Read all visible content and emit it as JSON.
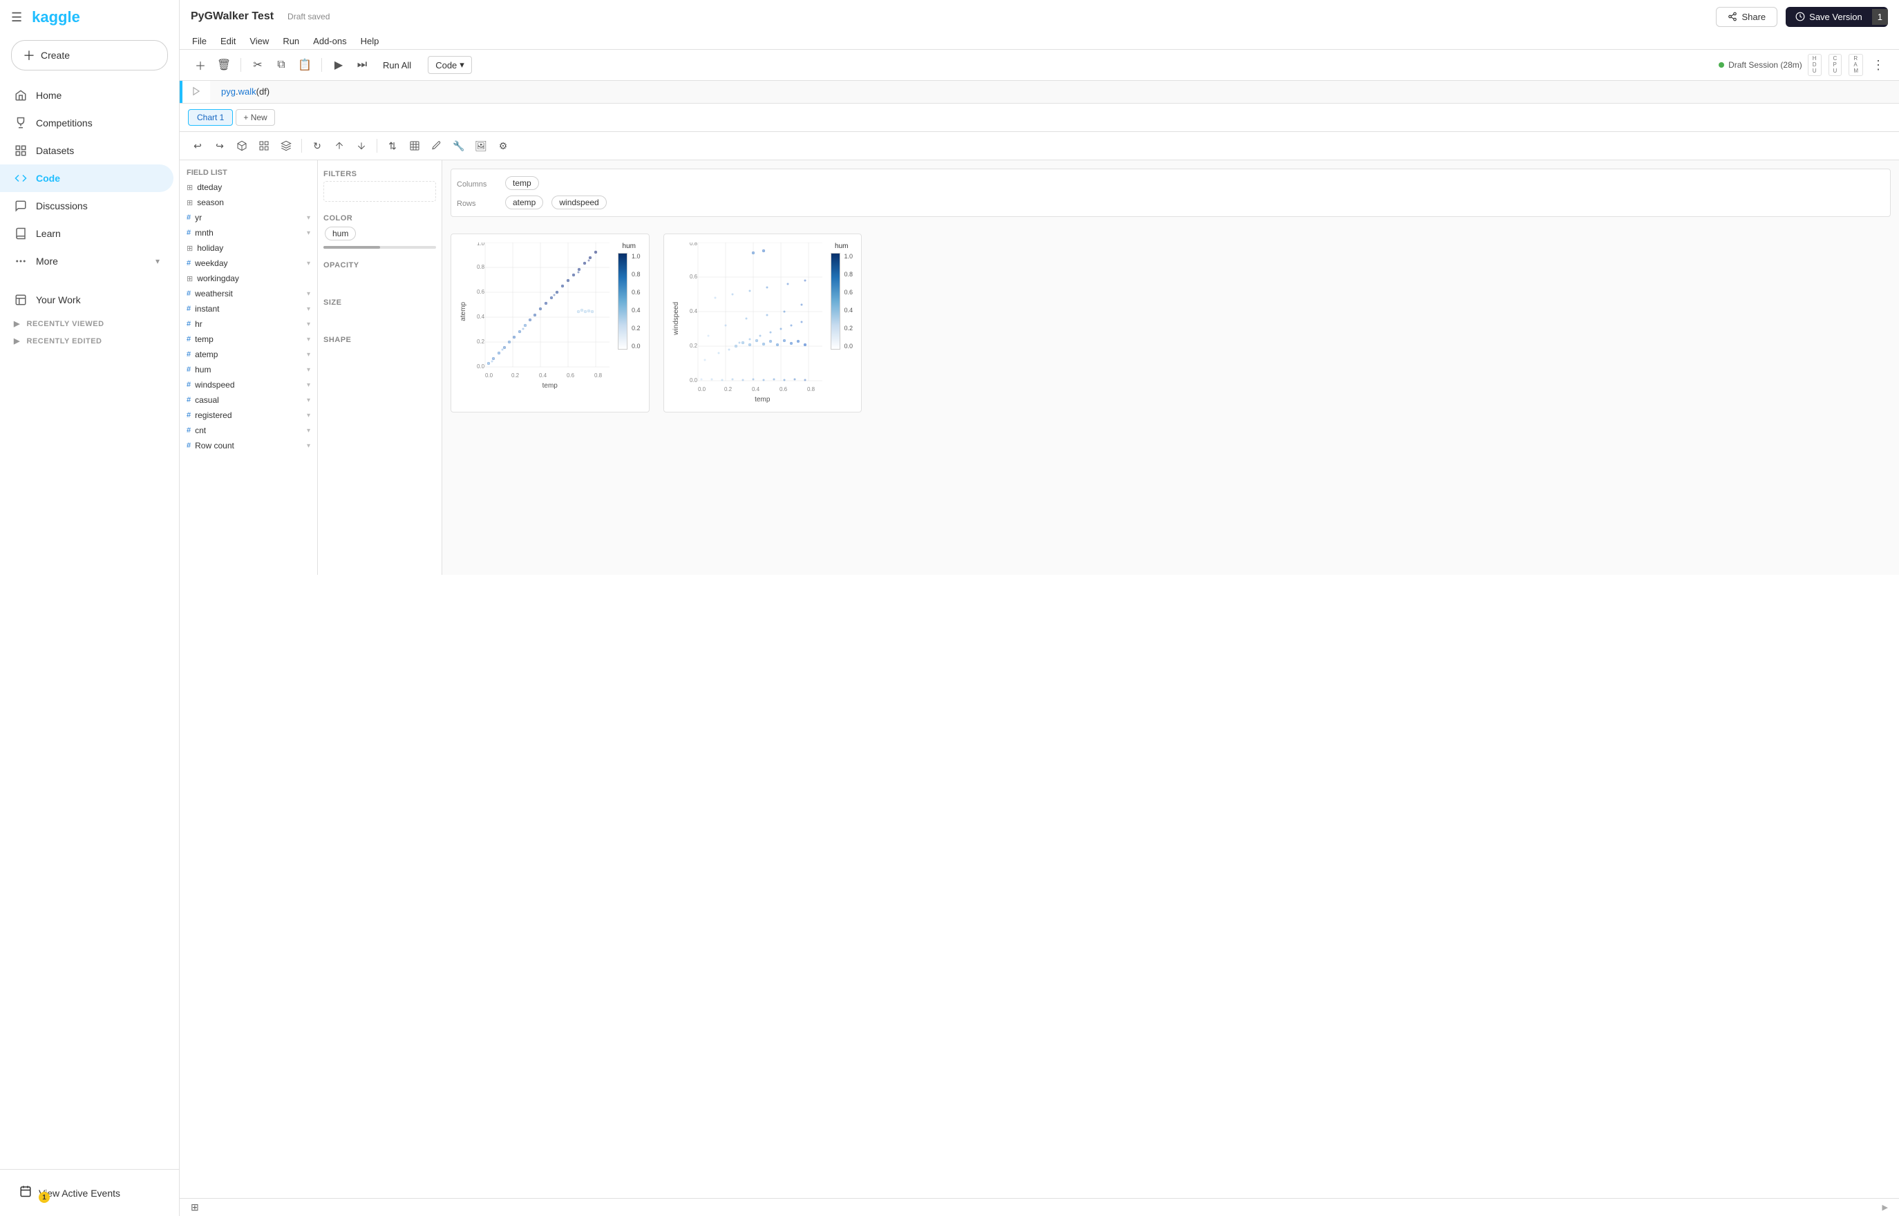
{
  "sidebar": {
    "logo": "kaggle",
    "create_label": "Create",
    "nav_items": [
      {
        "id": "home",
        "label": "Home",
        "icon": "home"
      },
      {
        "id": "competitions",
        "label": "Competitions",
        "icon": "trophy"
      },
      {
        "id": "datasets",
        "label": "Datasets",
        "icon": "grid"
      },
      {
        "id": "code",
        "label": "Code",
        "icon": "code",
        "active": true
      },
      {
        "id": "discussions",
        "label": "Discussions",
        "icon": "chat"
      },
      {
        "id": "learn",
        "label": "Learn",
        "icon": "book"
      },
      {
        "id": "more",
        "label": "More",
        "icon": "plus",
        "expandable": true
      }
    ],
    "your_work_label": "Your Work",
    "recently_viewed_label": "RECENTLY VIEWED",
    "recently_edited_label": "RECENTLY EDITED",
    "view_events_label": "View Active Events",
    "events_badge": "1"
  },
  "topbar": {
    "notebook_title": "PyGWalker Test",
    "draft_badge": "Draft saved",
    "menu_items": [
      "File",
      "Edit",
      "View",
      "Run",
      "Add-ons",
      "Help"
    ],
    "share_label": "Share",
    "save_version_label": "Save Version",
    "save_version_num": "1"
  },
  "toolbar": {
    "run_all_label": "Run All",
    "code_label": "Code",
    "session_label": "Draft Session (28m)",
    "resources": [
      "HDU",
      "CPU",
      "RAM"
    ],
    "hdu": "H\nD\nU",
    "cpu": "C\nP\nU",
    "ram": "R\nA\nM"
  },
  "code_cell": {
    "code": "pyg.walk(df)"
  },
  "pygwalker": {
    "chart_tabs": [
      {
        "id": "chart1",
        "label": "Chart 1",
        "active": true
      },
      {
        "id": "new",
        "label": "+ New"
      }
    ],
    "field_list_title": "Field List",
    "fields": [
      {
        "name": "dteday",
        "type": "cat"
      },
      {
        "name": "season",
        "type": "cat"
      },
      {
        "name": "yr",
        "type": "num"
      },
      {
        "name": "mnth",
        "type": "num"
      },
      {
        "name": "holiday",
        "type": "cat"
      },
      {
        "name": "weekday",
        "type": "num"
      },
      {
        "name": "workingday",
        "type": "cat"
      },
      {
        "name": "weathersit",
        "type": "num"
      },
      {
        "name": "instant",
        "type": "num"
      },
      {
        "name": "hr",
        "type": "num"
      },
      {
        "name": "temp",
        "type": "num"
      },
      {
        "name": "atemp",
        "type": "num"
      },
      {
        "name": "hum",
        "type": "num"
      },
      {
        "name": "windspeed",
        "type": "num"
      },
      {
        "name": "casual",
        "type": "num"
      },
      {
        "name": "registered",
        "type": "num"
      },
      {
        "name": "cnt",
        "type": "num"
      },
      {
        "name": "Row count",
        "type": "num"
      }
    ],
    "filters_label": "Filters",
    "color_label": "Color",
    "color_tag": "hum",
    "opacity_label": "Opacity",
    "size_label": "Size",
    "shape_label": "Shape",
    "columns_label": "Columns",
    "columns_tag": "temp",
    "rows_label": "Rows",
    "rows_tags": [
      "atemp",
      "windspeed"
    ],
    "chart1": {
      "x_label": "temp",
      "y_label": "atemp",
      "legend_label": "hum",
      "legend_values": [
        "1.0",
        "0.8",
        "0.6",
        "0.4",
        "0.2",
        "0.0"
      ]
    },
    "chart2": {
      "x_label": "temp",
      "y_label": "windspeed",
      "legend_label": "hum",
      "legend_values": [
        "1.0",
        "0.8",
        "0.6",
        "0.4",
        "0.2",
        "0.0"
      ]
    }
  }
}
